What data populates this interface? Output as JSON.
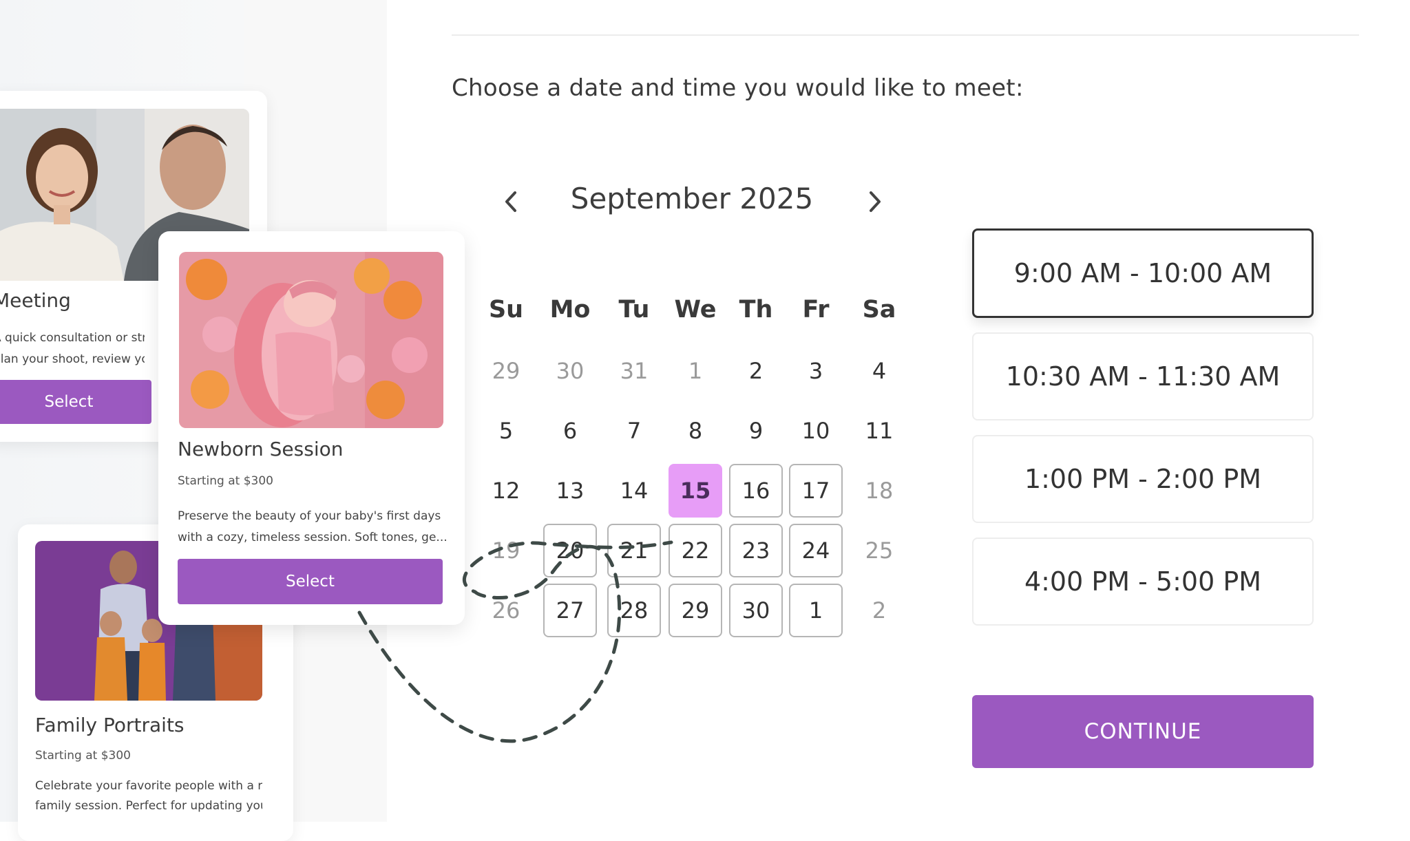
{
  "prompt": "Choose a date and time you would like to meet:",
  "calendar": {
    "month_label": "September 2025",
    "prev_icon": "chevron-left-icon",
    "next_icon": "chevron-right-icon",
    "weekdays": [
      "Su",
      "Mo",
      "Tu",
      "We",
      "Th",
      "Fr",
      "Sa"
    ],
    "weeks": [
      [
        "29",
        "30",
        "31",
        "1",
        "2",
        "3",
        "4"
      ],
      [
        "5",
        "6",
        "7",
        "8",
        "9",
        "10",
        "11"
      ],
      [
        "12",
        "13",
        "14",
        "15",
        "16",
        "17",
        "18"
      ],
      [
        "19",
        "20",
        "21",
        "22",
        "23",
        "24",
        "25"
      ],
      [
        "26",
        "27",
        "28",
        "29",
        "30",
        "1",
        "2"
      ]
    ],
    "selected_date": "15"
  },
  "time_slots": [
    {
      "label": "9:00 AM - 10:00 AM",
      "selected": true
    },
    {
      "label": "10:30 AM - 11:30 AM",
      "selected": false
    },
    {
      "label": "1:00 PM - 2:00 PM",
      "selected": false
    },
    {
      "label": "4:00 PM - 5:00 PM",
      "selected": false
    }
  ],
  "continue_label": "CONTINUE",
  "cards": {
    "meeting": {
      "title": "Meeting",
      "desc_line1": "A quick consultation or strateg",
      "desc_line2": "plan your shoot, review your v",
      "button": "Select"
    },
    "newborn": {
      "title": "Newborn Session",
      "price": "Starting at $300",
      "desc_line1": "Preserve the beauty of your baby's first days",
      "desc_line2": "with a cozy, timeless session. Soft tones, ge...",
      "button": "Select"
    },
    "family": {
      "title": "Family Portraits",
      "price": "Starting at $300",
      "desc_line1": "Celebrate your favorite people with a rela",
      "desc_line2": "family session. Perfect for updating your v"
    }
  },
  "colors": {
    "accent": "#9b59c0",
    "selected_day": "#e79df7",
    "dashed_line": "#3e4a47"
  }
}
